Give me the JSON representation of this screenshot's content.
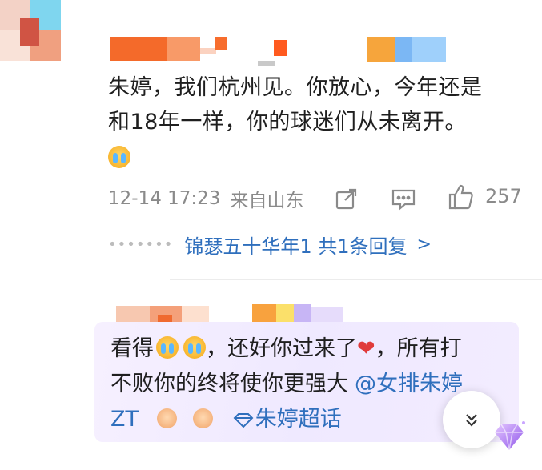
{
  "comment1": {
    "text_line1": "朱婷，我们杭州见。你放心，今年还是",
    "text_line2": "和18年一样，你的球迷们从未离开。",
    "emoji": "crying-emoji",
    "time": "12-14 17:23",
    "location": "来自山东",
    "like_count": "257",
    "reply_link": "锦瑟五十华年1  共1条回复",
    "reply_chevron": ">"
  },
  "comment2": {
    "line1_prefix": "看得",
    "line1_mid": "，还好你过来了",
    "line1_suffix": "，所有打",
    "line2_text": "不败你的终将使你更强大",
    "line2_mention": "@女排朱婷",
    "line3_prefix": "ZT",
    "topic": "朱婷超话",
    "emojis": [
      "crying-emoji",
      "crying-emoji",
      "heart",
      "fist-emoji",
      "fist-emoji"
    ]
  },
  "colors": {
    "link": "#2f6fbd",
    "meta": "#8a8a8a",
    "bubble": "#f3ecff",
    "heart": "#e03b3b"
  }
}
